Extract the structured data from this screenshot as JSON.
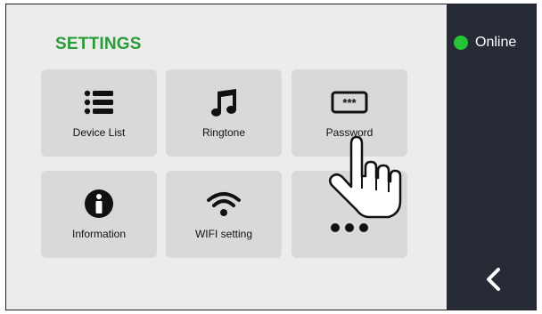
{
  "page": {
    "title": "SETTINGS"
  },
  "tiles": [
    {
      "label": "Device List",
      "icon": "list-icon"
    },
    {
      "label": "Ringtone",
      "icon": "music-note-icon"
    },
    {
      "label": "Password",
      "icon": "password-keyboard-icon",
      "icon_text": "***"
    },
    {
      "label": "Information",
      "icon": "info-icon"
    },
    {
      "label": "WIFI setting",
      "icon": "wifi-icon"
    },
    {
      "label": "",
      "icon": "more-dots-icon"
    }
  ],
  "sidebar": {
    "status_label": "Online",
    "status_color": "#22c534",
    "back_icon": "chevron-left-icon"
  },
  "pointer": {
    "icon": "hand-pointer-icon"
  },
  "colors": {
    "accent": "#2b9b3a",
    "sidebar_bg": "#262b36",
    "tile_bg": "#d9d9d9",
    "content_bg": "#ececeb"
  }
}
